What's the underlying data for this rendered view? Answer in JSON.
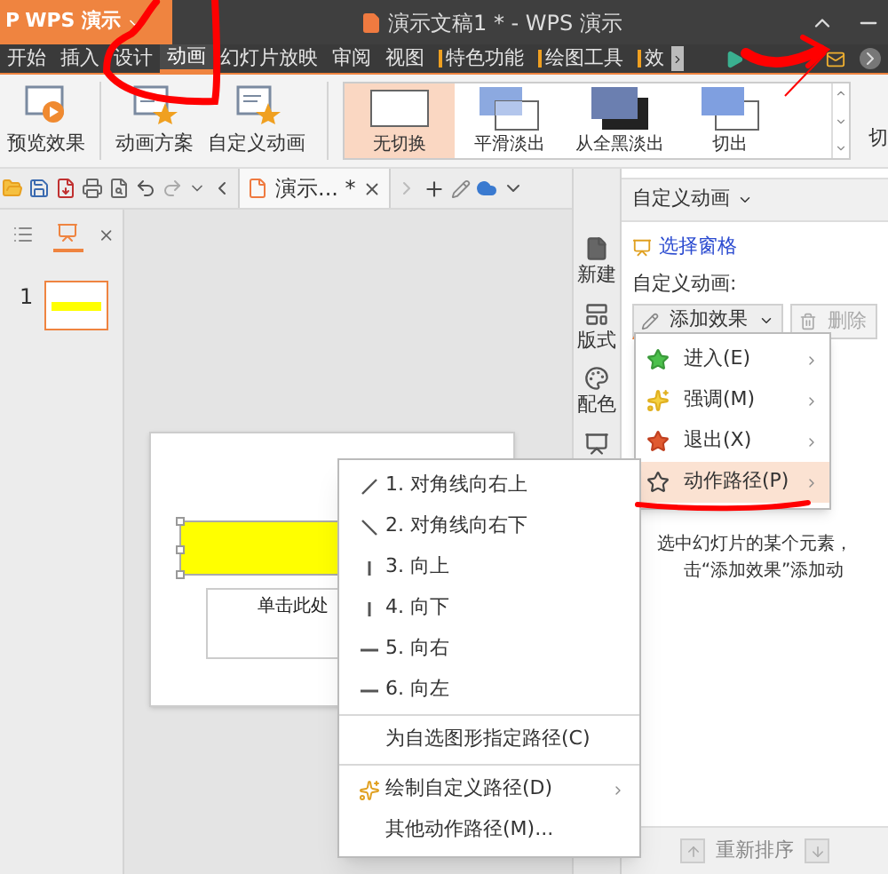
{
  "app_menu": {
    "logo": "P",
    "label": "WPS 演示"
  },
  "window": {
    "title": "演示文稿1 * - WPS 演示"
  },
  "menu_tabs": [
    {
      "label": "开始",
      "selected": false,
      "kind": "normal"
    },
    {
      "label": "插入",
      "selected": false,
      "kind": "normal"
    },
    {
      "label": "设计",
      "selected": false,
      "kind": "normal"
    },
    {
      "label": "动画",
      "selected": true,
      "kind": "normal"
    },
    {
      "label": "幻灯片放映",
      "selected": false,
      "kind": "normal"
    },
    {
      "label": "审阅",
      "selected": false,
      "kind": "normal"
    },
    {
      "label": "视图",
      "selected": false,
      "kind": "normal"
    },
    {
      "label": "特色功能",
      "selected": false,
      "kind": "context"
    },
    {
      "label": "绘图工具",
      "selected": false,
      "kind": "context"
    },
    {
      "label": "效",
      "selected": false,
      "kind": "context"
    }
  ],
  "ribbon": {
    "buttons": [
      {
        "label": "预览效果",
        "kind": "preview"
      },
      {
        "label": "动画方案",
        "kind": "scheme"
      },
      {
        "label": "自定义动画",
        "kind": "custom"
      }
    ],
    "transitions": [
      {
        "label": "无切换",
        "kind": "none",
        "selected": true
      },
      {
        "label": "平滑淡出",
        "kind": "fade",
        "selected": false
      },
      {
        "label": "从全黑淡出",
        "kind": "black",
        "selected": false
      },
      {
        "label": "切出",
        "kind": "cut",
        "selected": false
      }
    ],
    "next_label": "切"
  },
  "document_tab": {
    "label": "演示... *"
  },
  "slides_panel": {
    "tabs": [
      {
        "kind": "outline",
        "selected": false
      },
      {
        "kind": "slides",
        "selected": true
      }
    ],
    "slides": [
      {
        "number": "1",
        "selected": true
      }
    ]
  },
  "slide": {
    "text_box": "单击此处"
  },
  "side_tools": [
    {
      "label": "新建",
      "kind": "new"
    },
    {
      "label": "版式",
      "kind": "layout"
    },
    {
      "label": "配色",
      "kind": "color"
    },
    {
      "kind": "effects"
    }
  ],
  "task_pane": {
    "title": "自定义动画",
    "link": "选择窗格",
    "section_label": "自定义动画:",
    "add_button": "添加效果",
    "remove_button": {
      "label": "删除",
      "disabled": true
    },
    "hint": [
      "选中幻灯片的某个元素，",
      "击“添加效果”添加动"
    ],
    "reorder_label": "重新排序"
  },
  "effect_menu": [
    {
      "label": "进入(E)",
      "kind": "enter",
      "selected": false
    },
    {
      "label": "强调(M)",
      "kind": "emphasis",
      "selected": false
    },
    {
      "label": "退出(X)",
      "kind": "exit",
      "selected": false
    },
    {
      "label": "动作路径(P)",
      "kind": "path",
      "selected": true
    }
  ],
  "path_menu": [
    {
      "label": "1. 对角线向右上",
      "kind": "diag-up",
      "separator_before": false
    },
    {
      "label": "2. 对角线向右下",
      "kind": "diag-down",
      "separator_before": false
    },
    {
      "label": "3. 向上",
      "kind": "vertical",
      "separator_before": false
    },
    {
      "label": "4. 向下",
      "kind": "vertical",
      "separator_before": false
    },
    {
      "label": "5. 向右",
      "kind": "horizontal",
      "separator_before": false
    },
    {
      "label": "6. 向左",
      "kind": "horizontal",
      "separator_before": false
    },
    {
      "label": "为自选图形指定路径(C)",
      "kind": "plain",
      "separator_before": true
    },
    {
      "label": "绘制自定义路径(D)",
      "kind": "draw",
      "separator_before": true
    },
    {
      "label": "其他动作路径(M)...",
      "kind": "plain",
      "separator_before": false
    }
  ]
}
